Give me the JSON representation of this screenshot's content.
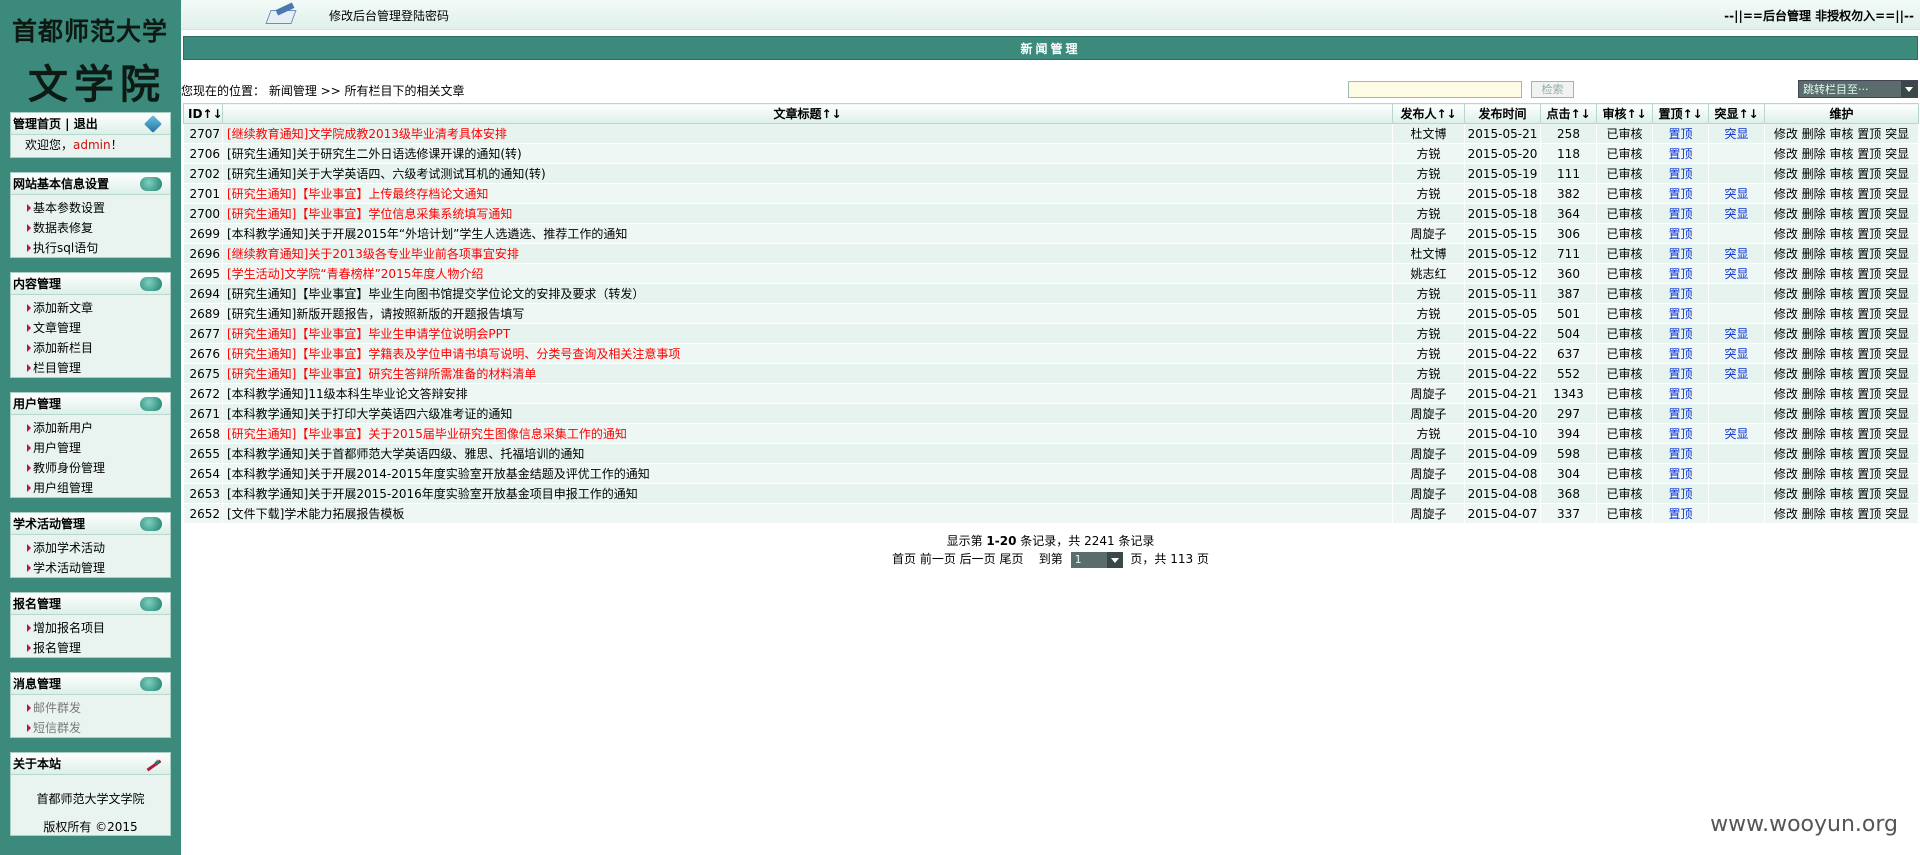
{
  "logo": {
    "line1": "首都师范大学",
    "line2": "文学院"
  },
  "topbar": {
    "link": "修改后台管理登陆密码",
    "notice": "--||==后台管理 非授权勿入==||--"
  },
  "title_bar": "新闻管理",
  "location": "您现在的位置： 新闻管理 >> 所有栏目下的相关文章",
  "search": {
    "button": "检索",
    "jump_label": "跳转栏目至···"
  },
  "sidebar": {
    "admin": {
      "title": "管理首页 | 退出",
      "welcome": "欢迎您，",
      "user": "admin",
      "suffix": "！"
    },
    "site": {
      "title": "网站基本信息设置",
      "items": [
        "基本参数设置",
        "数据表修复",
        "执行sql语句"
      ]
    },
    "content": {
      "title": "内容管理",
      "items": [
        "添加新文章",
        "文章管理",
        "添加新栏目",
        "栏目管理"
      ]
    },
    "users": {
      "title": "用户管理",
      "items": [
        "添加新用户",
        "用户管理",
        "教师身份管理",
        "用户组管理"
      ]
    },
    "academic": {
      "title": "学术活动管理",
      "items": [
        "添加学术活动",
        "学术活动管理"
      ]
    },
    "signup": {
      "title": "报名管理",
      "items": [
        "增加报名项目",
        "报名管理"
      ]
    },
    "message": {
      "title": "消息管理",
      "items": [
        "邮件群发",
        "短信群发"
      ]
    },
    "about": {
      "title": "关于本站",
      "name": "首都师范大学文学院",
      "copyright": "版权所有 ©2015"
    }
  },
  "table": {
    "headers": [
      "ID↑↓",
      "文章标题↑↓",
      "发布人↑↓",
      "发布时间",
      "点击↑↓",
      "审核↑↓",
      "置顶↑↓",
      "突显↑↓",
      "维护"
    ],
    "ops": "修改 删除 审核 置顶 突显",
    "rows": [
      {
        "id": "2707",
        "title": "[继续教育通知]文学院成教2013级毕业清考具体安排",
        "red": true,
        "author": "杜文博",
        "date": "2015-05-21",
        "clicks": "258",
        "audit": "已审核",
        "top": "置顶",
        "hl": "突显"
      },
      {
        "id": "2706",
        "title": "[研究生通知]关于研究生二外日语选修课开课的通知(转)",
        "red": false,
        "author": "方锐",
        "date": "2015-05-20",
        "clicks": "118",
        "audit": "已审核",
        "top": "置顶",
        "hl": ""
      },
      {
        "id": "2702",
        "title": "[研究生通知]关于大学英语四、六级考试测试耳机的通知(转)",
        "red": false,
        "author": "方锐",
        "date": "2015-05-19",
        "clicks": "111",
        "audit": "已审核",
        "top": "置顶",
        "hl": ""
      },
      {
        "id": "2701",
        "title": "[研究生通知]【毕业事宜】上传最终存档论文通知",
        "red": true,
        "author": "方锐",
        "date": "2015-05-18",
        "clicks": "382",
        "audit": "已审核",
        "top": "置顶",
        "hl": "突显"
      },
      {
        "id": "2700",
        "title": "[研究生通知]【毕业事宜】学位信息采集系统填写通知",
        "red": true,
        "author": "方锐",
        "date": "2015-05-18",
        "clicks": "364",
        "audit": "已审核",
        "top": "置顶",
        "hl": "突显"
      },
      {
        "id": "2699",
        "title": "[本科教学通知]关于开展2015年“外培计划”学生人选遴选、推荐工作的通知",
        "red": false,
        "author": "周旋子",
        "date": "2015-05-15",
        "clicks": "306",
        "audit": "已审核",
        "top": "置顶",
        "hl": ""
      },
      {
        "id": "2696",
        "title": "[继续教育通知]关于2013级各专业毕业前各项事宜安排",
        "red": true,
        "author": "杜文博",
        "date": "2015-05-12",
        "clicks": "711",
        "audit": "已审核",
        "top": "置顶",
        "hl": "突显"
      },
      {
        "id": "2695",
        "title": "[学生活动]文学院“青春榜样”2015年度人物介绍",
        "red": true,
        "author": "姚志红",
        "date": "2015-05-12",
        "clicks": "360",
        "audit": "已审核",
        "top": "置顶",
        "hl": "突显"
      },
      {
        "id": "2694",
        "title": "[研究生通知]【毕业事宜】毕业生向图书馆提交学位论文的安排及要求（转发）",
        "red": false,
        "author": "方锐",
        "date": "2015-05-11",
        "clicks": "387",
        "audit": "已审核",
        "top": "置顶",
        "hl": ""
      },
      {
        "id": "2689",
        "title": "[研究生通知]新版开题报告，请按照新版的开题报告填写",
        "red": false,
        "author": "方锐",
        "date": "2015-05-05",
        "clicks": "501",
        "audit": "已审核",
        "top": "置顶",
        "hl": ""
      },
      {
        "id": "2677",
        "title": "[研究生通知]【毕业事宜】毕业生申请学位说明会PPT",
        "red": true,
        "author": "方锐",
        "date": "2015-04-22",
        "clicks": "504",
        "audit": "已审核",
        "top": "置顶",
        "hl": "突显"
      },
      {
        "id": "2676",
        "title": "[研究生通知]【毕业事宜】学籍表及学位申请书填写说明、分类号查询及相关注意事项",
        "red": true,
        "author": "方锐",
        "date": "2015-04-22",
        "clicks": "637",
        "audit": "已审核",
        "top": "置顶",
        "hl": "突显"
      },
      {
        "id": "2675",
        "title": "[研究生通知]【毕业事宜】研究生答辩所需准备的材料清单",
        "red": true,
        "author": "方锐",
        "date": "2015-04-22",
        "clicks": "552",
        "audit": "已审核",
        "top": "置顶",
        "hl": "突显"
      },
      {
        "id": "2672",
        "title": "[本科教学通知]11级本科生毕业论文答辩安排",
        "red": false,
        "author": "周旋子",
        "date": "2015-04-21",
        "clicks": "1343",
        "audit": "已审核",
        "top": "置顶",
        "hl": ""
      },
      {
        "id": "2671",
        "title": "[本科教学通知]关于打印大学英语四六级准考证的通知",
        "red": false,
        "author": "周旋子",
        "date": "2015-04-20",
        "clicks": "297",
        "audit": "已审核",
        "top": "置顶",
        "hl": ""
      },
      {
        "id": "2658",
        "title": "[研究生通知]【毕业事宜】关于2015届毕业研究生图像信息采集工作的通知",
        "red": true,
        "author": "方锐",
        "date": "2015-04-10",
        "clicks": "394",
        "audit": "已审核",
        "top": "置顶",
        "hl": "突显"
      },
      {
        "id": "2655",
        "title": "[本科教学通知]关于首都师范大学英语四级、雅思、托福培训的通知",
        "red": false,
        "author": "周旋子",
        "date": "2015-04-09",
        "clicks": "598",
        "audit": "已审核",
        "top": "置顶",
        "hl": ""
      },
      {
        "id": "2654",
        "title": "[本科教学通知]关于开展2014-2015年度实验室开放基金结题及评优工作的通知",
        "red": false,
        "author": "周旋子",
        "date": "2015-04-08",
        "clicks": "304",
        "audit": "已审核",
        "top": "置顶",
        "hl": ""
      },
      {
        "id": "2653",
        "title": "[本科教学通知]关于开展2015-2016年度实验室开放基金项目申报工作的通知",
        "red": false,
        "author": "周旋子",
        "date": "2015-04-08",
        "clicks": "368",
        "audit": "已审核",
        "top": "置顶",
        "hl": ""
      },
      {
        "id": "2652",
        "title": "[文件下载]学术能力拓展报告模板",
        "red": false,
        "author": "周旋子",
        "date": "2015-04-07",
        "clicks": "337",
        "audit": "已审核",
        "top": "置顶",
        "hl": ""
      }
    ]
  },
  "pager": {
    "summary_pre": "显示第 ",
    "summary_range": "1-20",
    "summary_post": " 条记录，共 2241 条记录",
    "nav": "首页 前一页 后一页 尾页",
    "goto_pre": "到第",
    "current": "1",
    "goto_post": "页，共 113 页"
  },
  "watermark": "www.wooyun.org"
}
